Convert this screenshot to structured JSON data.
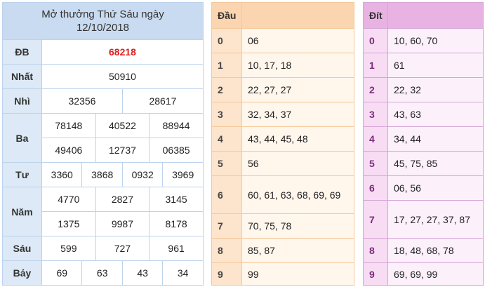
{
  "results": {
    "title": "Mở thưởng Thứ Sáu ngày",
    "date": "12/10/2018",
    "prizes": [
      {
        "label": "ĐB",
        "rows": [
          [
            "68218"
          ]
        ]
      },
      {
        "label": "Nhất",
        "rows": [
          [
            "50910"
          ]
        ]
      },
      {
        "label": "Nhì",
        "rows": [
          [
            "32356",
            "28617"
          ]
        ]
      },
      {
        "label": "Ba",
        "rows": [
          [
            "78148",
            "40522",
            "88944"
          ],
          [
            "49406",
            "12737",
            "06385"
          ]
        ]
      },
      {
        "label": "Tư",
        "rows": [
          [
            "3360",
            "3868",
            "0932",
            "3969"
          ]
        ]
      },
      {
        "label": "Năm",
        "rows": [
          [
            "4770",
            "2827",
            "3145"
          ],
          [
            "1375",
            "9987",
            "8178"
          ]
        ]
      },
      {
        "label": "Sáu",
        "rows": [
          [
            "599",
            "727",
            "961"
          ]
        ]
      },
      {
        "label": "Bảy",
        "rows": [
          [
            "69",
            "63",
            "43",
            "34"
          ]
        ]
      }
    ]
  },
  "dau": {
    "header": "Đầu",
    "rows": [
      {
        "digit": "0",
        "values": "06"
      },
      {
        "digit": "1",
        "values": "10, 17, 18"
      },
      {
        "digit": "2",
        "values": "22, 27, 27"
      },
      {
        "digit": "3",
        "values": "32, 34, 37"
      },
      {
        "digit": "4",
        "values": "43, 44, 45, 48"
      },
      {
        "digit": "5",
        "values": "56"
      },
      {
        "digit": "6",
        "values": "60, 61, 63, 68, 69, 69"
      },
      {
        "digit": "7",
        "values": "70, 75, 78"
      },
      {
        "digit": "8",
        "values": "85, 87"
      },
      {
        "digit": "9",
        "values": "99"
      }
    ]
  },
  "dit": {
    "header": "Đít",
    "rows": [
      {
        "digit": "0",
        "values": "10, 60, 70"
      },
      {
        "digit": "1",
        "values": "61"
      },
      {
        "digit": "2",
        "values": "22, 32"
      },
      {
        "digit": "3",
        "values": "43, 63"
      },
      {
        "digit": "4",
        "values": "34, 44"
      },
      {
        "digit": "5",
        "values": "45, 75, 85"
      },
      {
        "digit": "6",
        "values": "06, 56"
      },
      {
        "digit": "7",
        "values": "17, 27, 27, 37, 87"
      },
      {
        "digit": "8",
        "values": "18, 48, 68, 78"
      },
      {
        "digit": "9",
        "values": "69, 69, 99"
      }
    ]
  },
  "colors": {
    "special_prize": "#e02020",
    "results_header": "#c9dbf0",
    "dau_accent": "#fbd5b0",
    "dit_accent": "#e8b3e3"
  }
}
